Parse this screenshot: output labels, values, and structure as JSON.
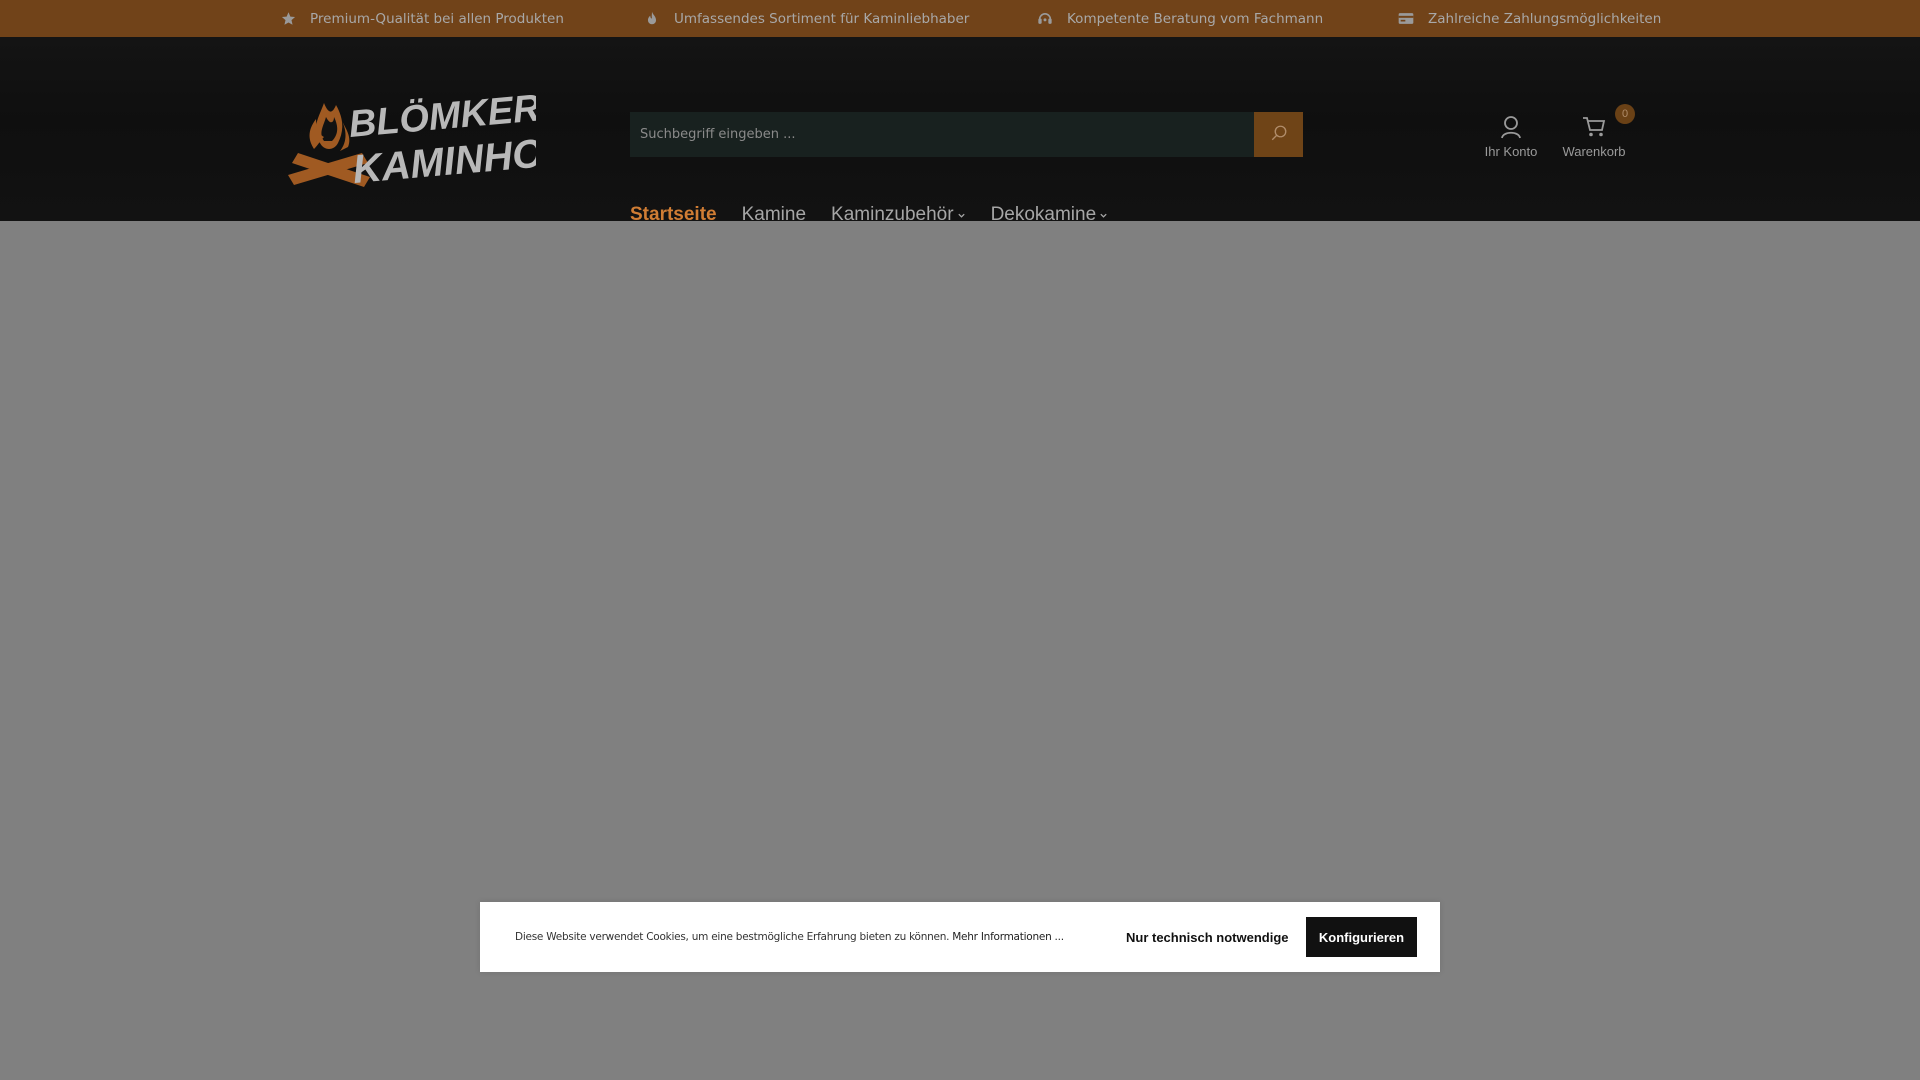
{
  "usp_bar": {
    "items": [
      {
        "icon": "star-icon",
        "text": "Premium-Qualität bei allen Produkten"
      },
      {
        "icon": "flame-icon",
        "text": "Umfassendes Sortiment für Kaminliebhaber"
      },
      {
        "icon": "headset-icon",
        "text": "Kompetente Beratung vom Fachmann"
      },
      {
        "icon": "credit-card-icon",
        "text": "Zahlreiche Zahlungsmöglichkeiten"
      }
    ]
  },
  "header": {
    "logo": {
      "line1": "BLÖMKER",
      "line2": "KAMINHOLZ"
    },
    "search": {
      "placeholder": "Suchbegriff eingeben ..."
    },
    "nav": [
      {
        "label": "Startseite",
        "active": true
      },
      {
        "label": "Kamine"
      },
      {
        "label": "Kaminzubehör",
        "has_dropdown": true
      },
      {
        "label": "Dekokamine",
        "has_dropdown": true
      }
    ],
    "account_label": "Ihr Konto",
    "cart_label": "Warenkorb",
    "cart_count": "0"
  },
  "cookie_banner": {
    "text": "Diese Website verwendet Cookies, um eine bestmögliche Erfahrung bieten zu können.",
    "more_link": "Mehr Informationen ...",
    "necessary_button": "Nur technisch notwendige",
    "configure_button": "Konfigurieren"
  },
  "colors": {
    "usp_bar_bg": "#714319",
    "accent": "#d07d34",
    "search_button": "#6f4417",
    "overlay": "#808080"
  }
}
